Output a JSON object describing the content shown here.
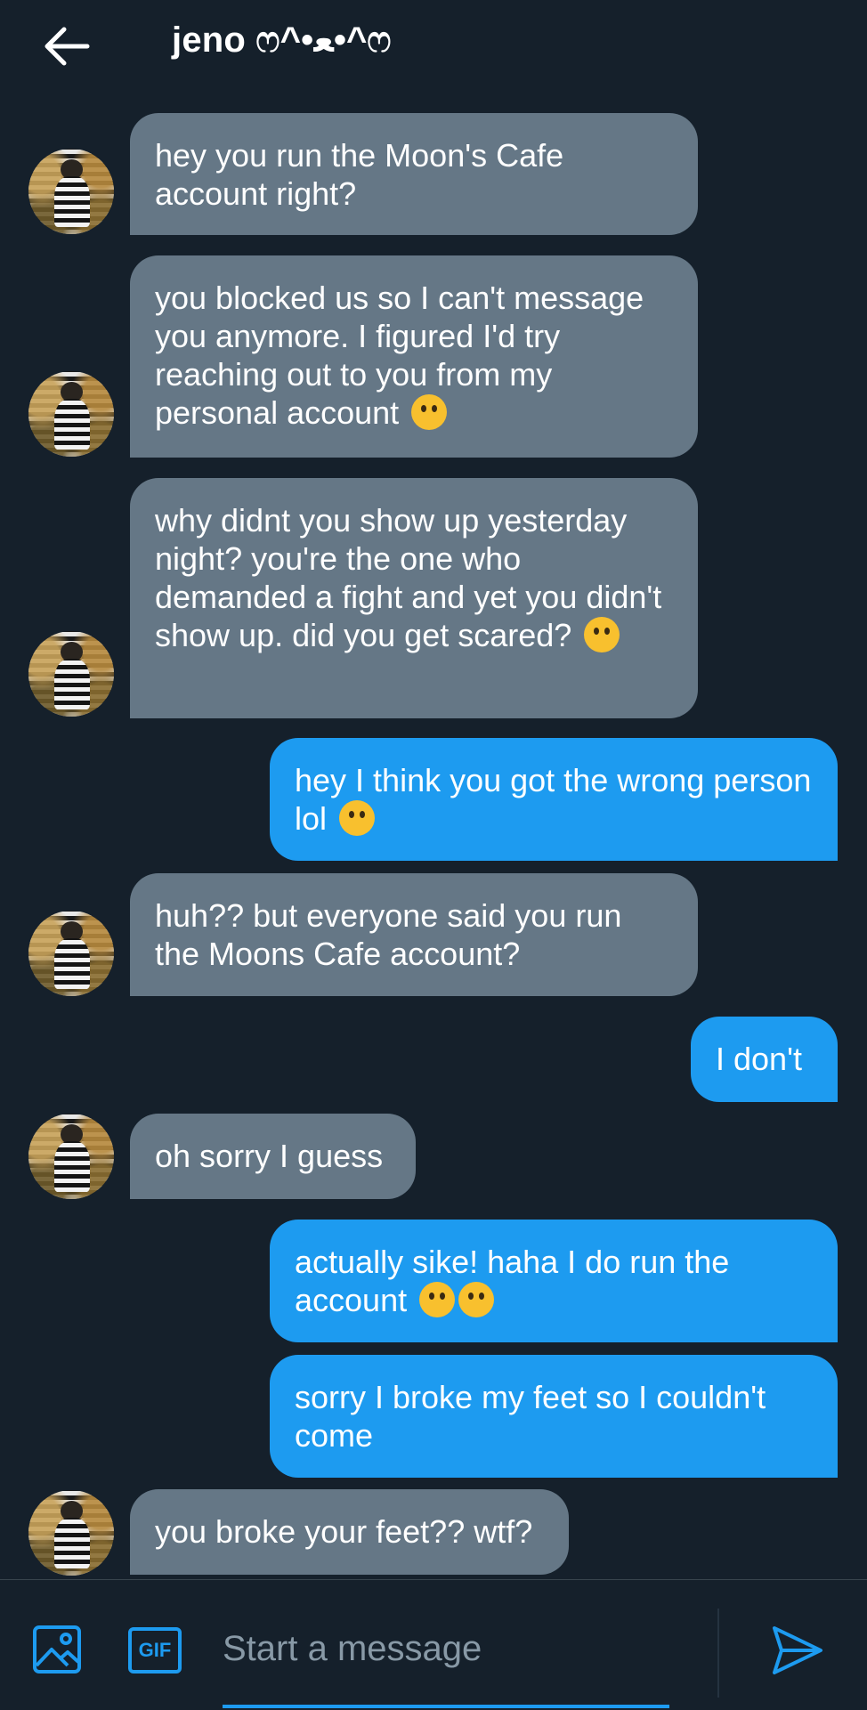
{
  "header": {
    "title": "jeno ෆ^•ﻌ•^ෆ"
  },
  "messages": [
    {
      "from": "them",
      "text": "hey you run the Moon's Cafe account right?"
    },
    {
      "from": "them",
      "text": "you blocked us so I can't message you anymore. I figured I'd try reaching out to you from my personal account",
      "emoji": "upside-down-face"
    },
    {
      "from": "them",
      "text": "why didnt you show up yesterday night? you're the one who demanded a fight and yet you didn't show up. did you get scared?",
      "emoji": "raised-eyebrow-face"
    },
    {
      "from": "me",
      "text": "hey I think you got the wrong person lol",
      "emoji": "grinning-sweat-face"
    },
    {
      "from": "them",
      "text": "huh?? but everyone said you run the Moons Cafe account?"
    },
    {
      "from": "me",
      "text": "I don't"
    },
    {
      "from": "them",
      "text": "oh sorry I guess"
    },
    {
      "from": "me",
      "text": "actually sike! haha I do run the account",
      "emoji": "zany-face",
      "emoji_count": 2
    },
    {
      "from": "me",
      "text": "sorry I broke my feet so I couldn't come"
    },
    {
      "from": "them",
      "text": "you broke your feet?? wtf?"
    }
  ],
  "composer": {
    "placeholder": "Start a message",
    "gif_label": "GIF"
  },
  "colors": {
    "background": "#15202b",
    "received_bubble": "#657786",
    "sent_bubble": "#1d9bf0",
    "accent": "#1d9bf0"
  },
  "icons": {
    "back": "arrow-left-icon",
    "media": "image-icon",
    "gif": "gif-icon",
    "send": "send-icon"
  }
}
